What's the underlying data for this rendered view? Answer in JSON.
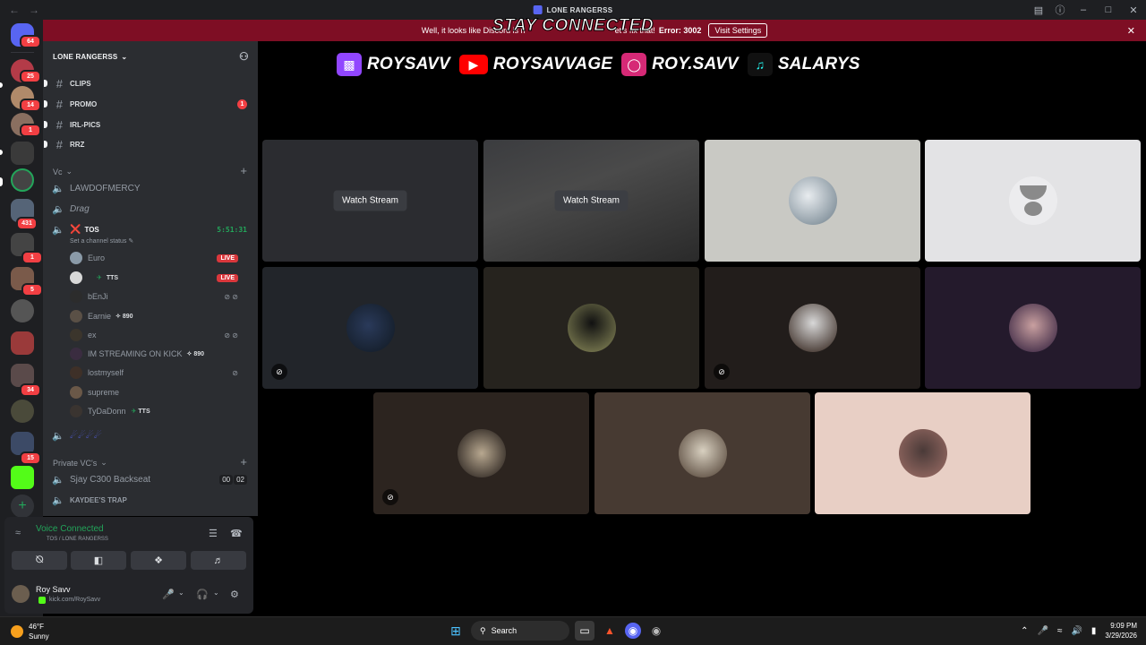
{
  "window": {
    "title": "LONE RANGERSS",
    "back_icon": "arrow-left-icon",
    "forward_icon": "arrow-right-icon"
  },
  "banner": {
    "message": "Well, it looks like Discord is n",
    "message_tail": "et's fix that!",
    "error": "Error: 3002",
    "button": "Visit Settings"
  },
  "overlay_text": "STAY CONNECTED",
  "server_rail": {
    "home_badge": "64",
    "badges": [
      "25",
      "14",
      "1",
      "431",
      "1",
      "5",
      "34",
      "15"
    ]
  },
  "sidebar": {
    "server_name": "LONE RANGERSS",
    "text_channels": [
      {
        "name": "CLIPS",
        "badge": ""
      },
      {
        "name": "PROMO",
        "badge": "1"
      },
      {
        "name": "IRL-PICS",
        "badge": ""
      },
      {
        "name": "RRZ",
        "badge": ""
      }
    ],
    "category_vc": "Vc",
    "voice_channels_top": [
      "LAWDOFMERCY",
      "Drag"
    ],
    "active_channel": {
      "name": "TOS",
      "timer": "5:51:31",
      "status_hint": "Set a channel status"
    },
    "members": [
      {
        "name": "Euro",
        "tag": "",
        "live": "LIVE"
      },
      {
        "name": "",
        "tag": "TTS",
        "live": "LIVE"
      },
      {
        "name": "bEnJi",
        "tag": "",
        "live": ""
      },
      {
        "name": "Earnie",
        "tag": "890",
        "live": ""
      },
      {
        "name": "ex",
        "tag": "",
        "live": ""
      },
      {
        "name": "IM STREAMING ON KICK",
        "tag": "890",
        "live": ""
      },
      {
        "name": "lostmyself",
        "tag": "",
        "live": ""
      },
      {
        "name": "supreme",
        "tag": "",
        "live": ""
      },
      {
        "name": "TyDaDonn",
        "tag": "TTS",
        "live": ""
      }
    ],
    "emoji_channel": "☄☄☄☄",
    "category_private": "Private VC's",
    "private_channels": [
      {
        "name": "Sjay C300 Backseat",
        "count_a": "00",
        "count_b": "02"
      },
      {
        "name": "KAYDEE'S TRAP"
      }
    ]
  },
  "voice_panel": {
    "status": "Voice Connected",
    "sub": "TOS / LONE RANGERSS",
    "user_name": "Roy Savv",
    "user_sub": "kick.com/RoySavv"
  },
  "socials": [
    {
      "platform": "twitch",
      "handle": "ROYSAVV",
      "color": "#9146ff"
    },
    {
      "platform": "youtube",
      "handle": "ROYSAVVAGE",
      "color": "#ff0000"
    },
    {
      "platform": "instagram",
      "handle": "ROY.SAVV",
      "color": "#d62976"
    },
    {
      "platform": "tiktok",
      "handle": "SALARYS",
      "color": "#111111"
    }
  ],
  "stream_tiles": {
    "watch_label": "Watch Stream"
  },
  "taskbar": {
    "temp": "46°F",
    "condition": "Sunny",
    "search": "Search",
    "time": "9:09 PM",
    "date": "3/29/2026"
  },
  "colors": {
    "discord_blurple": "#5865f2",
    "banner_red": "#7e0e24",
    "voice_green": "#23a55a",
    "live_red": "#da373c"
  }
}
